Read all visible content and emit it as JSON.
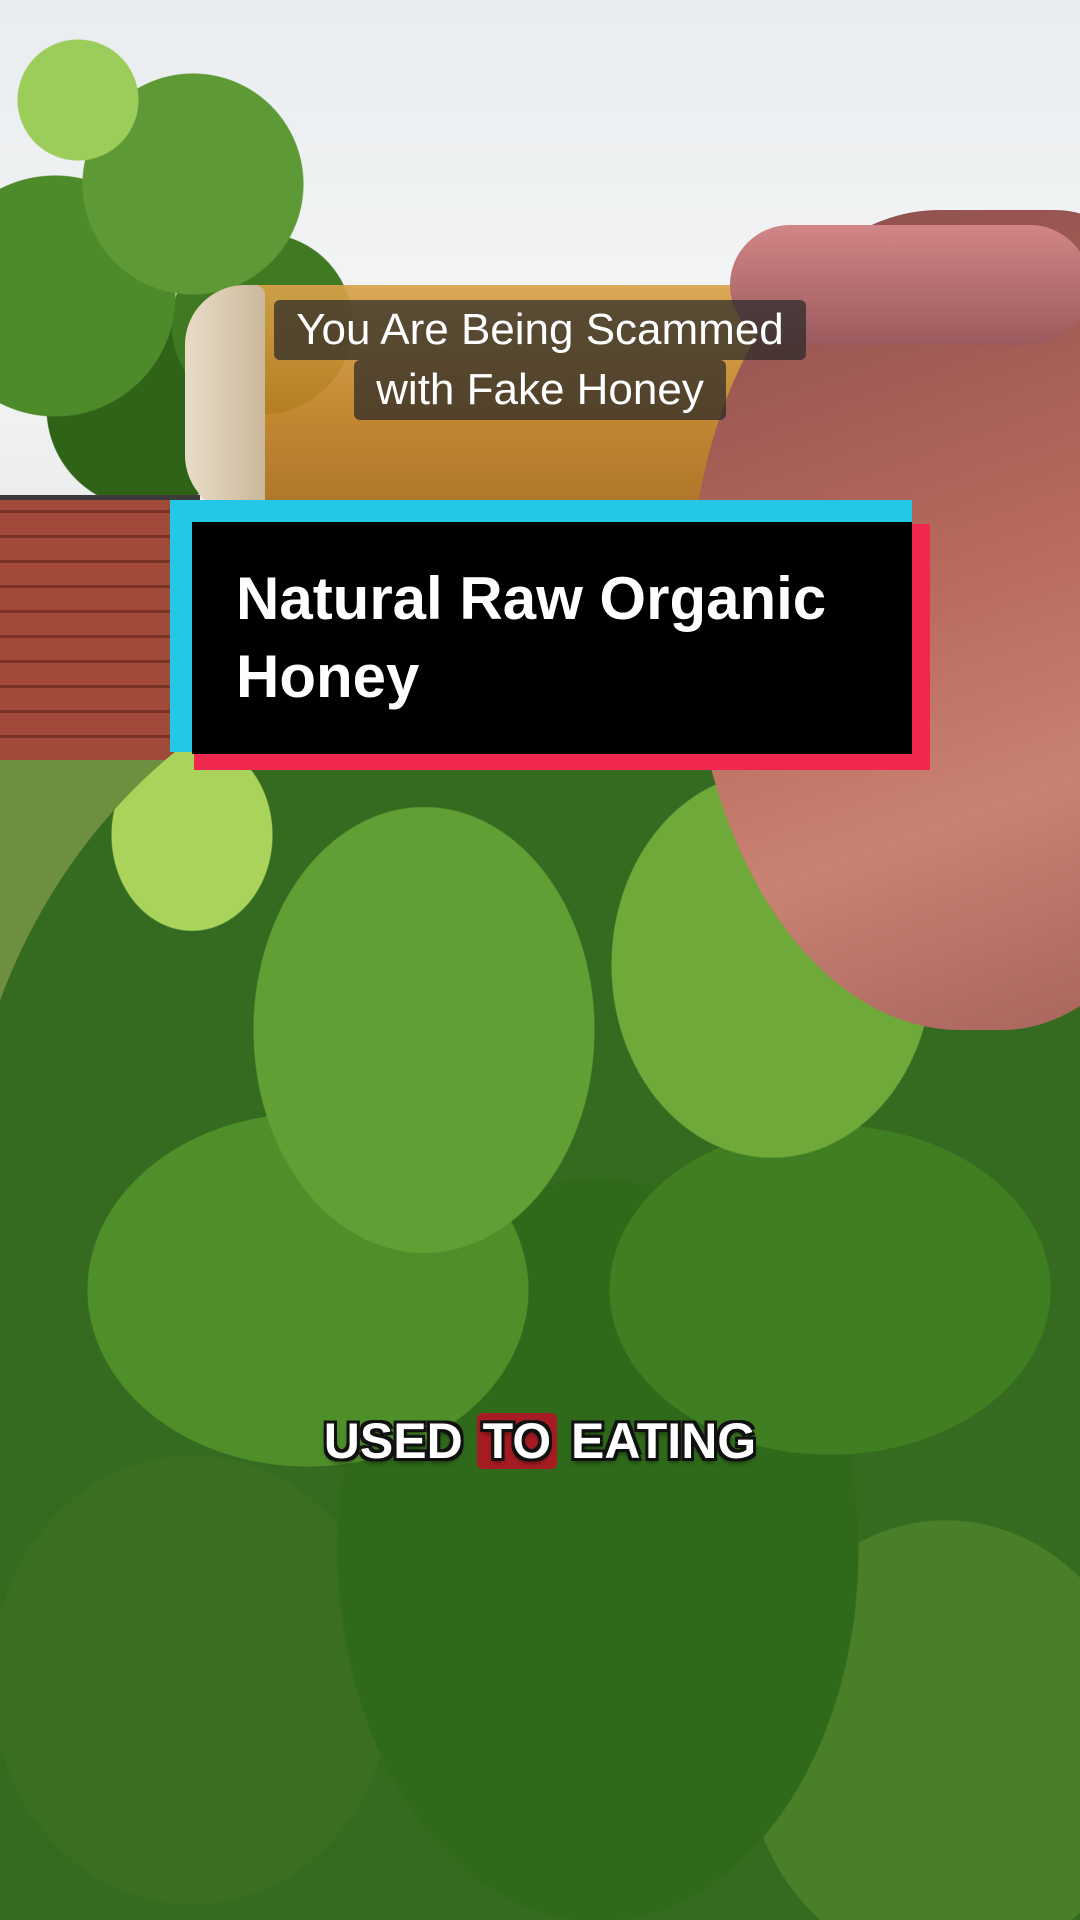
{
  "video": {
    "top_caption": {
      "line1": "You Are Being Scammed",
      "line2": "with Fake Honey"
    },
    "banner": {
      "title": "Natural Raw Organic Honey",
      "colors": {
        "accent_left": "#25c7e6",
        "accent_right": "#f0284f",
        "fill": "#000000"
      }
    },
    "subtitle": {
      "before": "USED ",
      "highlight": "TO",
      "after": " EATING",
      "highlight_color": "#a61c22"
    }
  }
}
